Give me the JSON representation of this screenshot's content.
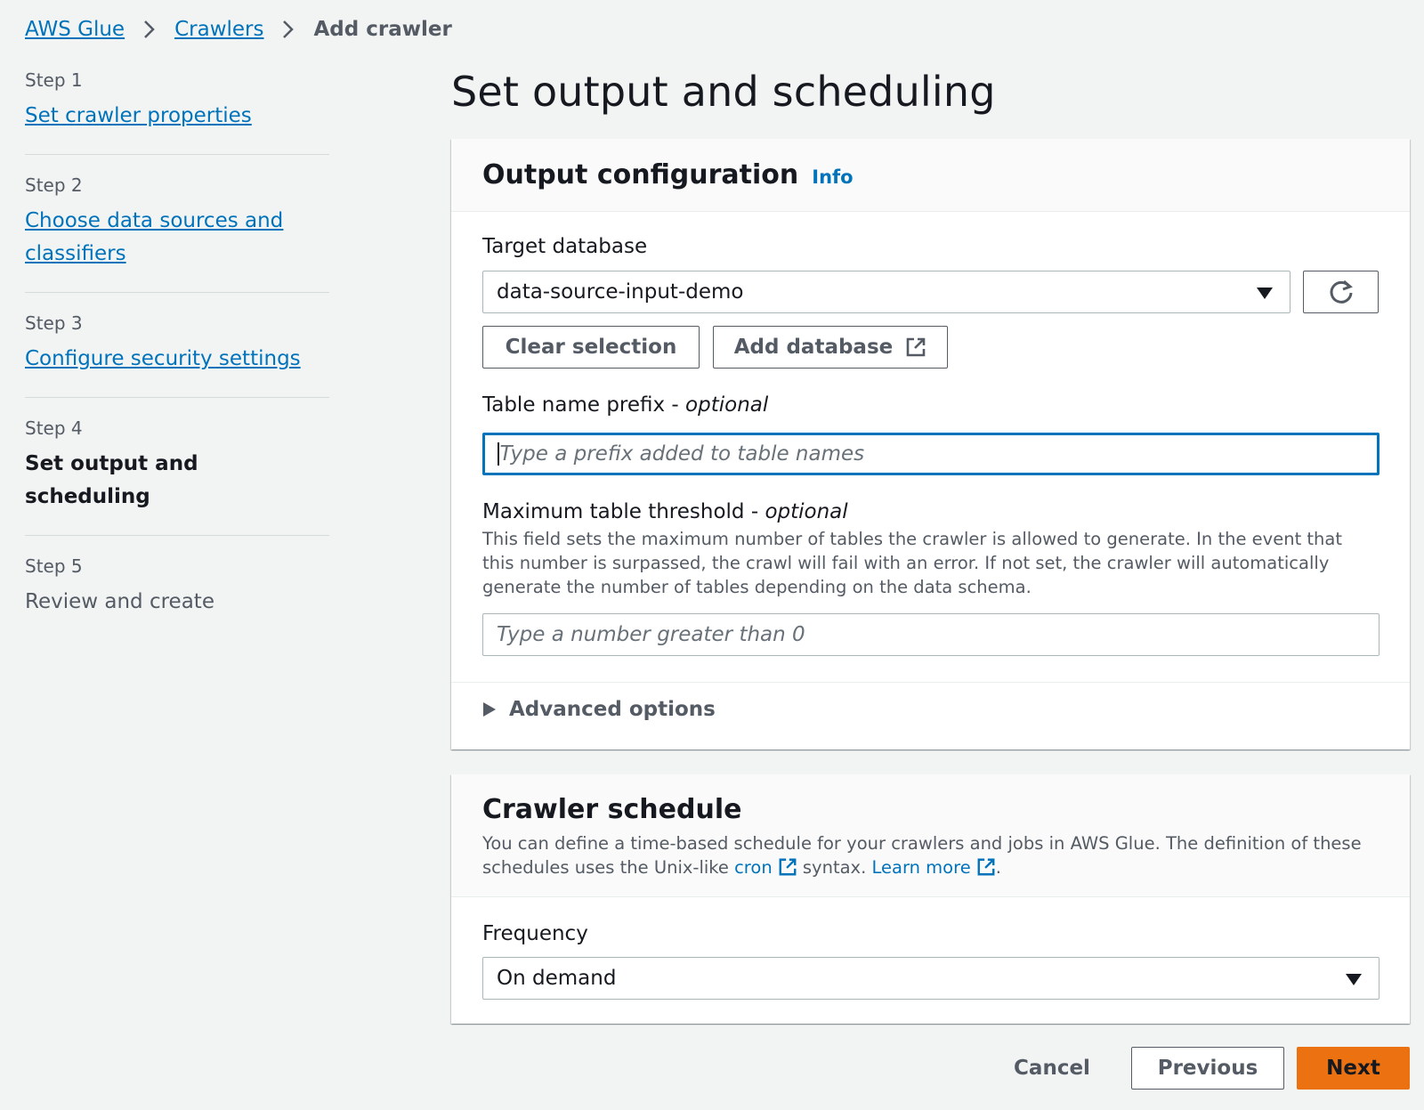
{
  "breadcrumb": {
    "items": [
      "AWS Glue",
      "Crawlers"
    ],
    "current": "Add crawler"
  },
  "steps": [
    {
      "num": "Step 1",
      "title": "Set crawler properties",
      "state": "link"
    },
    {
      "num": "Step 2",
      "title_line1": "Choose data sources and",
      "title_line2": "classifiers",
      "state": "link"
    },
    {
      "num": "Step 3",
      "title": "Configure security settings",
      "state": "link"
    },
    {
      "num": "Step 4",
      "title": "Set output and scheduling",
      "state": "active"
    },
    {
      "num": "Step 5",
      "title": "Review and create",
      "state": "disabled"
    }
  ],
  "page_title": "Set output and scheduling",
  "output_config": {
    "title": "Output configuration",
    "info": "Info",
    "target_database_label": "Target database",
    "target_database_value": "data-source-input-demo",
    "clear_selection": "Clear selection",
    "add_database": "Add database",
    "prefix_label": "Table name prefix - ",
    "prefix_optional": "optional",
    "prefix_placeholder": "Type a prefix added to table names",
    "threshold_label": "Maximum table threshold - ",
    "threshold_optional": "optional",
    "threshold_desc": "This field sets the maximum number of tables the crawler is allowed to generate. In the event that this number is surpassed, the crawl will fail with an error. If not set, the crawler will automatically generate the number of tables depending on the data schema.",
    "threshold_placeholder": "Type a number greater than 0",
    "advanced_options": "Advanced options"
  },
  "crawler_schedule": {
    "title": "Crawler schedule",
    "desc_part1": "You can define a time-based schedule for your crawlers and jobs in AWS Glue. The definition of these schedules uses the Unix-like ",
    "cron_link": "cron",
    "desc_part2": " syntax. ",
    "learn_more": "Learn more",
    "desc_end": ".",
    "frequency_label": "Frequency",
    "frequency_value": "On demand"
  },
  "footer": {
    "cancel": "Cancel",
    "previous": "Previous",
    "next": "Next"
  },
  "colors": {
    "link": "#0073bb",
    "primary_button": "#ec7211",
    "background": "#f2f3f3"
  }
}
